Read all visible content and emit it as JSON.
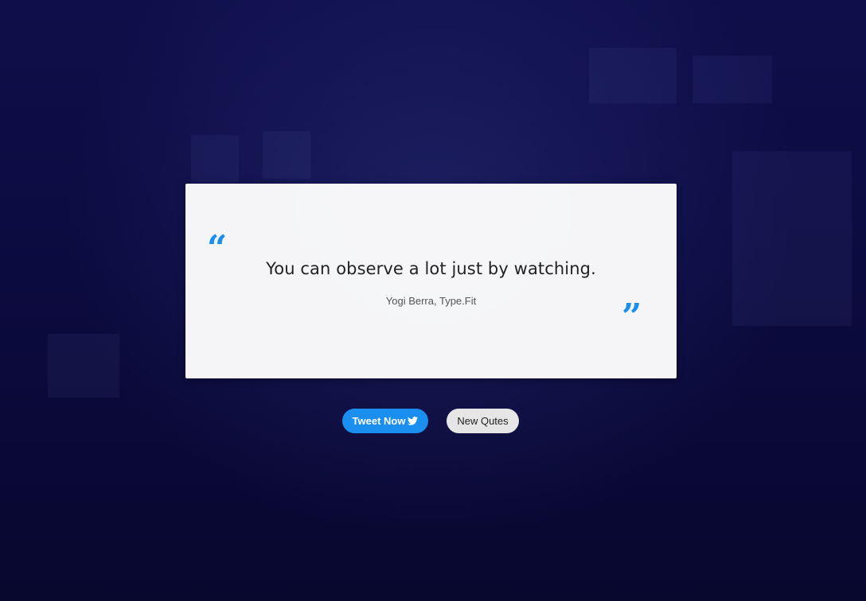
{
  "quote": {
    "text": "You can observe a lot just by watching.",
    "author": "Yogi Berra, Type.Fit",
    "open_icon": "quote-left-icon",
    "close_icon": "quote-right-icon"
  },
  "buttons": {
    "tweet_label": "Tweet Now",
    "tweet_icon": "twitter-bird-icon",
    "new_label": "New Qutes"
  },
  "colors": {
    "accent": "#1a8ff0",
    "background": "#0b0a3a",
    "card": "#ffffff"
  }
}
